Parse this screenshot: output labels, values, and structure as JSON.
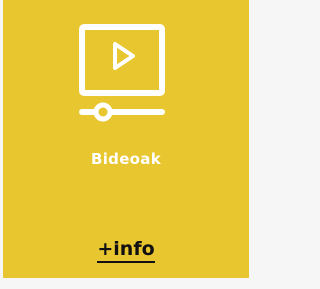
{
  "card": {
    "title": "Bideoak",
    "link_label": "+info",
    "icon": "video-player-icon",
    "background_color": "#e8c62f",
    "title_color": "#ffffff",
    "link_color": "#111111"
  }
}
